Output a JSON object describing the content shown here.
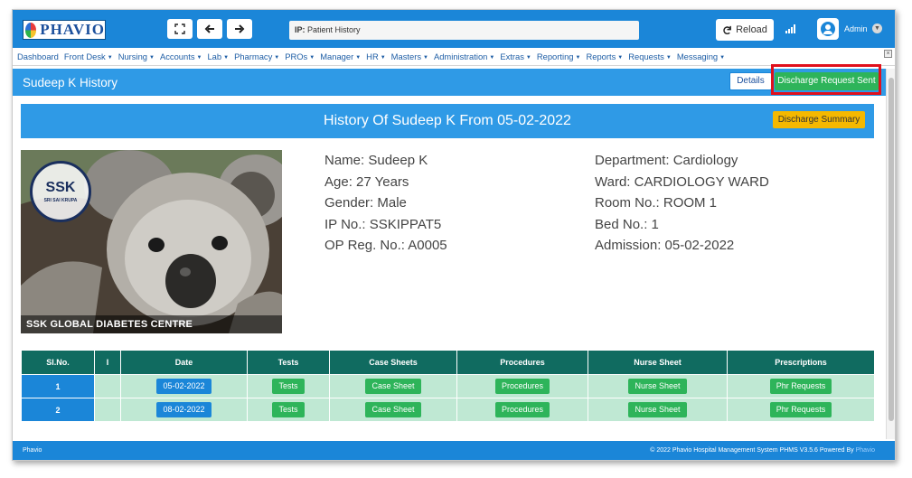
{
  "app": {
    "brand": "PHAVIO",
    "ip_label": "IP:",
    "ip_value": "Patient History",
    "reload_label": "Reload",
    "user_label": "Admin"
  },
  "menu": [
    {
      "label": "Dashboard",
      "has_caret": false
    },
    {
      "label": "Front Desk",
      "has_caret": true
    },
    {
      "label": "Nursing",
      "has_caret": true
    },
    {
      "label": "Accounts",
      "has_caret": true
    },
    {
      "label": "Lab",
      "has_caret": true
    },
    {
      "label": "Pharmacy",
      "has_caret": true
    },
    {
      "label": "PROs",
      "has_caret": true
    },
    {
      "label": "Manager",
      "has_caret": true
    },
    {
      "label": "HR",
      "has_caret": true
    },
    {
      "label": "Masters",
      "has_caret": true
    },
    {
      "label": "Administration",
      "has_caret": true
    },
    {
      "label": "Extras",
      "has_caret": true
    },
    {
      "label": "Reporting",
      "has_caret": true
    },
    {
      "label": "Reports",
      "has_caret": true
    },
    {
      "label": "Requests",
      "has_caret": true
    },
    {
      "label": "Messaging",
      "has_caret": true
    }
  ],
  "page": {
    "title": "Sudeep K History",
    "details_label": "Details",
    "discharge_label": "Discharge Request Sent",
    "banner_title": "History Of Sudeep K From 05-02-2022",
    "summary_label": "Discharge Summary"
  },
  "photo": {
    "seal_text": "SSK",
    "seal_sub": "SRI SAI KRUPA",
    "caption": "SSK GLOBAL DIABETES CENTRE"
  },
  "patient": {
    "left": [
      "Name: Sudeep K",
      "Age: 27 Years",
      "Gender: Male",
      "IP No.: SSKIPPAT5",
      "OP Reg. No.: A0005"
    ],
    "right": [
      "Department: Cardiology",
      "Ward: CARDIOLOGY WARD",
      "Room No.: ROOM 1",
      "Bed No.: 1",
      "Admission: 05-02-2022"
    ]
  },
  "table": {
    "headers": [
      "Sl.No.",
      "I",
      "Date",
      "Tests",
      "Case Sheets",
      "Procedures",
      "Nurse Sheet",
      "Prescriptions"
    ],
    "rows": [
      {
        "slno": "1",
        "date": "05-02-2022",
        "tests": "Tests",
        "case": "Case Sheet",
        "proc": "Procedures",
        "nurse": "Nurse Sheet",
        "presc": "Phr Requests"
      },
      {
        "slno": "2",
        "date": "08-02-2022",
        "tests": "Tests",
        "case": "Case Sheet",
        "proc": "Procedures",
        "nurse": "Nurse Sheet",
        "presc": "Phr Requests"
      }
    ]
  },
  "footer": {
    "left": "Phavio",
    "right_prefix": "© 2022 Phavio Hospital Management System PHMS V3.5.6 Powered By",
    "right_brand": "Phavio"
  },
  "colors": {
    "primary": "#1b86d8",
    "header_blue": "#2f9ae6",
    "success": "#2eb45a",
    "warning": "#f5b800",
    "table_head": "#106b60",
    "table_row": "#bfe8d3",
    "highlight": "#e0101c"
  },
  "icons": {
    "fullscreen": "fullscreen-icon",
    "back": "arrow-left-icon",
    "forward": "arrow-right-icon",
    "reload": "reload-icon",
    "signal": "signal-icon",
    "user": "user-icon",
    "caret": "chevron-down-icon"
  }
}
